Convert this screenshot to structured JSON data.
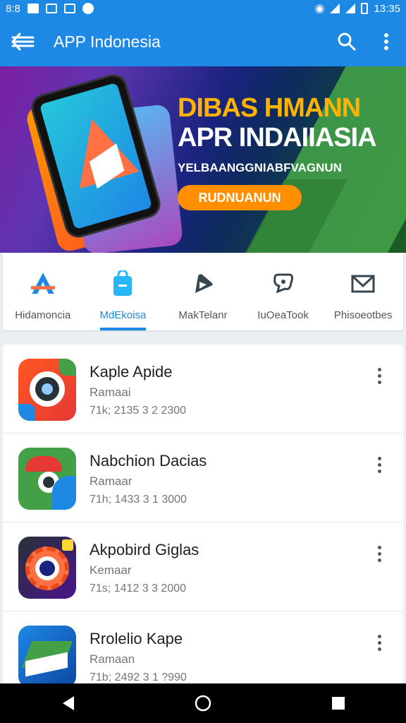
{
  "status_bar": {
    "time_left": "8:8",
    "time_right": "13:35"
  },
  "app_bar": {
    "title": "APP Indonesia",
    "icons": [
      "back-arrow-icon",
      "search-icon",
      "more-vert-icon"
    ]
  },
  "banner": {
    "headline": "DIBAS HMANN",
    "subheadline": "APR INDAIIASIA",
    "tagline": "YELBAANGGNIABFVAGNUN",
    "cta_label": "RUDNUANUN"
  },
  "categories": [
    {
      "label": "Hidamoncia",
      "icon": "app-store-icon",
      "active": false
    },
    {
      "label": "MdEkoisa",
      "icon": "shopping-bag-icon",
      "active": true
    },
    {
      "label": "MakTelanr",
      "icon": "play-arrow-icon",
      "active": false
    },
    {
      "label": "IuOeaTook",
      "icon": "chat-bubble-icon",
      "active": false
    },
    {
      "label": "Phisoeotbes",
      "icon": "mail-icon",
      "active": false
    }
  ],
  "apps": [
    {
      "name": "Kaple Apide",
      "category": "Ramaai",
      "meta": "71k; 2135 3 2 2300"
    },
    {
      "name": "Nabchion Dacias",
      "category": "Ramaar",
      "meta": "71h; 1433 3 1 3000"
    },
    {
      "name": "Akpobird Giglas",
      "category": "Kemaar",
      "meta": "71s; 1412 3 3 2000"
    },
    {
      "name": "Rrolelio Kape",
      "category": "Ramaan",
      "meta": "71b; 2492 3 1 ?990"
    }
  ],
  "colors": {
    "primary": "#1e88e5",
    "cta": "#ff8f00",
    "headline": "#ffb300"
  },
  "nav_bar": {
    "icons": [
      "back-triangle-icon",
      "home-circle-icon",
      "recents-square-icon"
    ]
  }
}
